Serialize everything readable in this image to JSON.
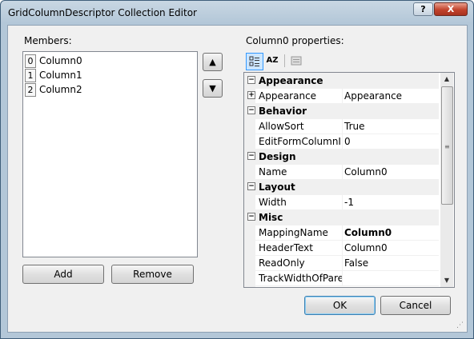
{
  "window": {
    "title": "GridColumnDescriptor Collection Editor",
    "help_label": "?",
    "close_label": "X"
  },
  "members": {
    "label": "Members:",
    "items": [
      {
        "index": "0",
        "name": "Column0"
      },
      {
        "index": "1",
        "name": "Column1"
      },
      {
        "index": "2",
        "name": "Column2"
      }
    ],
    "move_up_label": "▲",
    "move_down_label": "▼",
    "add_label": "Add",
    "remove_label": "Remove"
  },
  "properties": {
    "label": "Column0 properties:",
    "toolbar": {
      "categorized_icon": "categorized-icon",
      "alphabetical_label": "AZ",
      "property_pages_icon": "property-pages-icon"
    },
    "rows": [
      {
        "type": "category",
        "expander": "⊟",
        "name": "Appearance"
      },
      {
        "type": "property",
        "expander": "⊞",
        "name": "Appearance",
        "value": "Appearance"
      },
      {
        "type": "category",
        "expander": "⊟",
        "name": "Behavior"
      },
      {
        "type": "property",
        "name": "AllowSort",
        "value": "True"
      },
      {
        "type": "property",
        "name": "EditFormColumnIn",
        "value": "0"
      },
      {
        "type": "category",
        "expander": "⊟",
        "name": "Design"
      },
      {
        "type": "property",
        "name": "Name",
        "value": "Column0"
      },
      {
        "type": "category",
        "expander": "⊟",
        "name": "Layout"
      },
      {
        "type": "property",
        "name": "Width",
        "value": "-1"
      },
      {
        "type": "category",
        "expander": "⊟",
        "name": "Misc"
      },
      {
        "type": "property",
        "name": "MappingName",
        "value": "Column0"
      },
      {
        "type": "property",
        "name": "HeaderText",
        "value": "Column0"
      },
      {
        "type": "property",
        "name": "ReadOnly",
        "value": "False"
      },
      {
        "type": "property",
        "name": "TrackWidthOfParer",
        "value": ""
      }
    ]
  },
  "footer": {
    "ok_label": "OK",
    "cancel_label": "Cancel"
  }
}
